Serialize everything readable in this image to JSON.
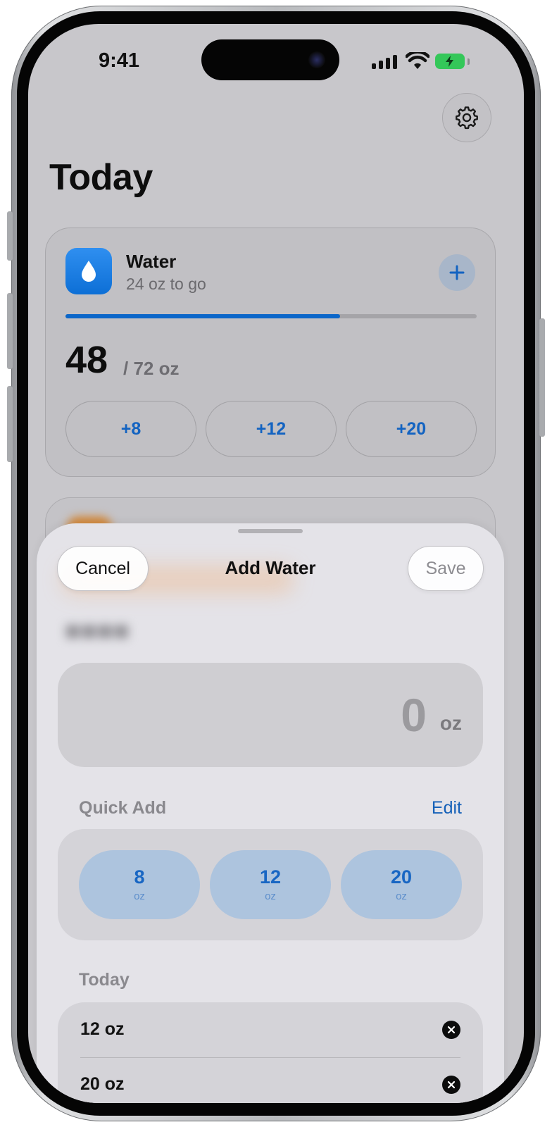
{
  "status_bar": {
    "time": "9:41"
  },
  "header": {
    "title": "Today"
  },
  "water_card": {
    "title": "Water",
    "subtitle": "24 oz to go",
    "progress": 0.667,
    "amount": "48",
    "goal": "/ 72 oz",
    "quick_buttons": [
      "+8",
      "+12",
      "+20"
    ]
  },
  "sheet": {
    "cancel_label": "Cancel",
    "title": "Add Water",
    "save_label": "Save",
    "input_value": "0",
    "input_unit": "oz",
    "quick_add_label": "Quick Add",
    "edit_label": "Edit",
    "quick_add": [
      {
        "value": "8",
        "unit": "oz"
      },
      {
        "value": "12",
        "unit": "oz"
      },
      {
        "value": "20",
        "unit": "oz"
      }
    ],
    "today_label": "Today",
    "entries": [
      "12 oz",
      "20 oz"
    ]
  },
  "colors": {
    "accent": "#1363c1",
    "progress": "#0b66c9",
    "app_icon": "#1a7ee6",
    "battery": "#34c759"
  },
  "icons": [
    "gear-icon",
    "water-drop-icon",
    "plus-icon",
    "close-icon",
    "signal-icon",
    "wifi-icon",
    "battery-icon"
  ]
}
